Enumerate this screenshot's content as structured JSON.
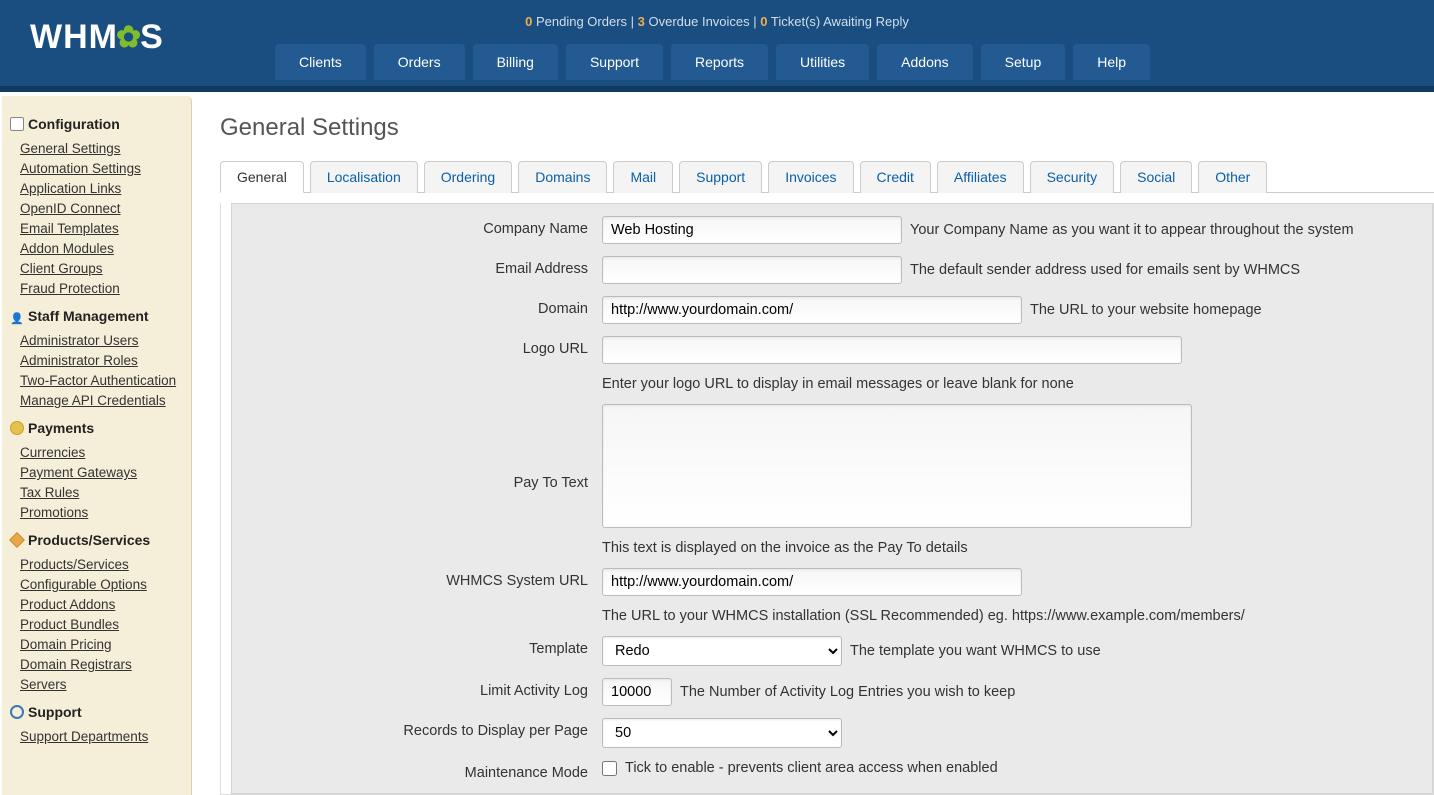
{
  "header": {
    "logo_pre": "WHM",
    "logo_post": "S",
    "pending_orders_count": "0",
    "pending_orders_label": " Pending Orders",
    "overdue_invoices_count": "3",
    "overdue_invoices_label": " Overdue Invoices",
    "tickets_count": "0",
    "tickets_label": " Ticket(s) Awaiting Reply",
    "sep": " | "
  },
  "nav": [
    "Clients",
    "Orders",
    "Billing",
    "Support",
    "Reports",
    "Utilities",
    "Addons",
    "Setup",
    "Help"
  ],
  "sidebar": {
    "sections": [
      {
        "title": "Configuration",
        "icon": "ic-cfg",
        "items": [
          "General Settings",
          "Automation Settings",
          "Application Links",
          "OpenID Connect",
          "Email Templates",
          "Addon Modules",
          "Client Groups",
          "Fraud Protection"
        ]
      },
      {
        "title": "Staff Management",
        "icon": "ic-user",
        "items": [
          "Administrator Users",
          "Administrator Roles",
          "Two-Factor Authentication",
          "Manage API Credentials"
        ]
      },
      {
        "title": "Payments",
        "icon": "ic-pay",
        "items": [
          "Currencies",
          "Payment Gateways",
          "Tax Rules",
          "Promotions"
        ]
      },
      {
        "title": "Products/Services",
        "icon": "ic-prod",
        "items": [
          "Products/Services",
          "Configurable Options",
          "Product Addons",
          "Product Bundles",
          "Domain Pricing",
          "Domain Registrars",
          "Servers"
        ]
      },
      {
        "title": "Support",
        "icon": "ic-sup",
        "items": [
          "Support Departments"
        ]
      }
    ]
  },
  "page": {
    "title": "General Settings"
  },
  "tabs": [
    "General",
    "Localisation",
    "Ordering",
    "Domains",
    "Mail",
    "Support",
    "Invoices",
    "Credit",
    "Affiliates",
    "Security",
    "Social",
    "Other"
  ],
  "form": {
    "company_name": {
      "label": "Company Name",
      "value": "Web Hosting",
      "hint": "Your Company Name as you want it to appear throughout the system"
    },
    "email": {
      "label": "Email Address",
      "value": "",
      "hint": "The default sender address used for emails sent by WHMCS"
    },
    "domain": {
      "label": "Domain",
      "value": "http://www.yourdomain.com/",
      "hint": "The URL to your website homepage"
    },
    "logo_url": {
      "label": "Logo URL",
      "value": "",
      "hint": "Enter your logo URL to display in email messages or leave blank for none"
    },
    "pay_to": {
      "label": "Pay To Text",
      "value": "",
      "hint": "This text is displayed on the invoice as the Pay To details"
    },
    "system_url": {
      "label": "WHMCS System URL",
      "value": "http://www.yourdomain.com/",
      "hint": "The URL to your WHMCS installation (SSL Recommended) eg. https://www.example.com/members/"
    },
    "template": {
      "label": "Template",
      "value": "Redo",
      "hint": "The template you want WHMCS to use"
    },
    "activity_log": {
      "label": "Limit Activity Log",
      "value": "10000",
      "hint": "The Number of Activity Log Entries you wish to keep"
    },
    "records_per_page": {
      "label": "Records to Display per Page",
      "value": "50"
    },
    "maintenance": {
      "label": "Maintenance Mode",
      "hint": "Tick to enable - prevents client area access when enabled"
    }
  }
}
